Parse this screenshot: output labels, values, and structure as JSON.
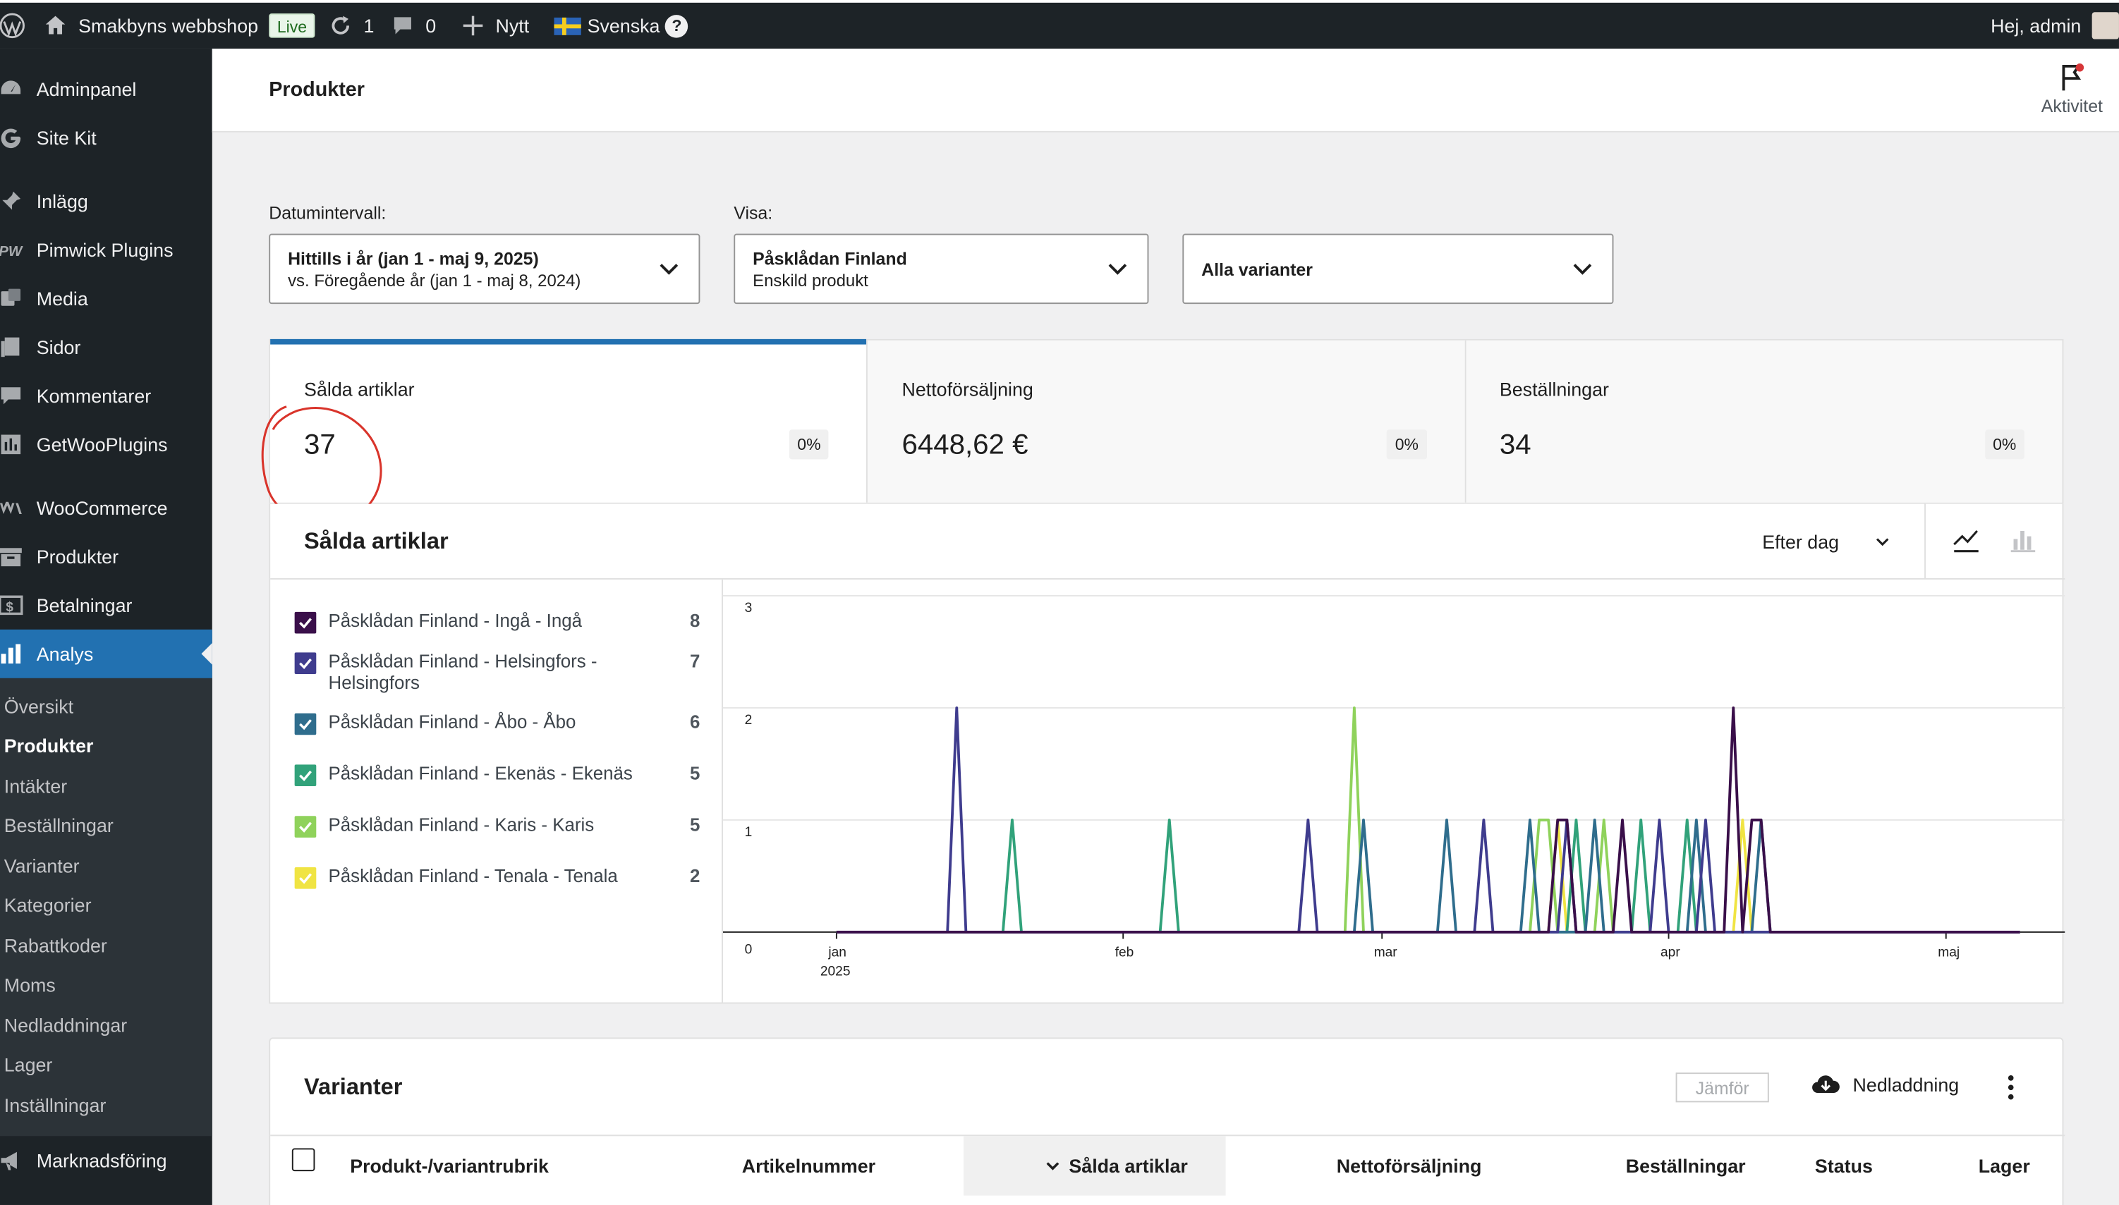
{
  "adminbar": {
    "site_name": "Smakbyns webbshop",
    "live_badge": "Live",
    "updates_count": "1",
    "comments_count": "0",
    "new_label": "Nytt",
    "language": "Svenska",
    "help_glyph": "?",
    "greeting": "Hej, admin"
  },
  "sidebar": {
    "items": [
      {
        "label": "Adminpanel",
        "icon": "dashboard-icon"
      },
      {
        "label": "Site Kit",
        "icon": "google-g-icon"
      },
      {
        "label": "Inlägg",
        "icon": "pin-icon"
      },
      {
        "label": "Pimwick Plugins",
        "icon": "pw-logo-icon"
      },
      {
        "label": "Media",
        "icon": "media-icon"
      },
      {
        "label": "Sidor",
        "icon": "pages-icon"
      },
      {
        "label": "Kommentarer",
        "icon": "comment-icon"
      },
      {
        "label": "GetWooPlugins",
        "icon": "plugin-grid-icon"
      },
      {
        "label": "WooCommerce",
        "icon": "woo-icon"
      },
      {
        "label": "Produkter",
        "icon": "archive-icon"
      },
      {
        "label": "Betalningar",
        "icon": "dollar-icon"
      },
      {
        "label": "Analys",
        "icon": "bar-chart-icon"
      }
    ],
    "submenu": [
      "Översikt",
      "Produkter",
      "Intäkter",
      "Beställningar",
      "Varianter",
      "Kategorier",
      "Rabattkoder",
      "Moms",
      "Nedladdningar",
      "Lager",
      "Inställningar"
    ],
    "after_submenu": [
      {
        "label": "Marknadsföring",
        "icon": "megaphone-icon"
      }
    ]
  },
  "header": {
    "title": "Produkter",
    "activity_label": "Aktivitet"
  },
  "filters": {
    "date_label": "Datumintervall:",
    "date_main": "Hittills i år (jan 1 - maj 9, 2025)",
    "date_sub": "vs. Föregående år (jan 1 - maj 8, 2024)",
    "show_label": "Visa:",
    "show_main": "Påsklådan Finland",
    "show_sub": "Enskild produkt",
    "variant_main": "Alla varianter"
  },
  "summary": [
    {
      "label": "Sålda artiklar",
      "value": "37",
      "delta": "0%"
    },
    {
      "label": "Nettoförsäljning",
      "value": "6448,62 €",
      "delta": "0%"
    },
    {
      "label": "Beställningar",
      "value": "34",
      "delta": "0%"
    }
  ],
  "chart_panel": {
    "title": "Sålda artiklar",
    "interval": "Efter dag"
  },
  "chart_data": {
    "type": "line",
    "ylim": [
      0,
      3
    ],
    "y_ticks": [
      "0",
      "1",
      "2",
      "3"
    ],
    "x_ticks": [
      {
        "label": "jan",
        "sub": "2025",
        "date": "2025-01-01"
      },
      {
        "label": "feb",
        "sub": "",
        "date": "2025-02-01"
      },
      {
        "label": "mar",
        "sub": "",
        "date": "2025-03-01"
      },
      {
        "label": "apr",
        "sub": "",
        "date": "2025-04-01"
      },
      {
        "label": "maj",
        "sub": "",
        "date": "2025-05-01"
      }
    ],
    "x_range": [
      "2025-01-01",
      "2025-05-09"
    ],
    "series": [
      {
        "name": "Påsklådan Finland - Ingå - Ingå",
        "total": "8",
        "color": "#3a0f4a",
        "points": [
          [
            "2025-03-20",
            1
          ],
          [
            "2025-03-21",
            1
          ],
          [
            "2025-03-27",
            1
          ],
          [
            "2025-04-08",
            2
          ],
          [
            "2025-04-10",
            1
          ],
          [
            "2025-04-11",
            1
          ]
        ]
      },
      {
        "name": "Påsklådan Finland - Helsingfors - Helsingfors",
        "total": "7",
        "color": "#3f3c8e",
        "points": [
          [
            "2025-01-14",
            2
          ],
          [
            "2025-02-21",
            1
          ],
          [
            "2025-03-12",
            1
          ],
          [
            "2025-03-21",
            1
          ],
          [
            "2025-03-31",
            1
          ],
          [
            "2025-04-05",
            1
          ]
        ]
      },
      {
        "name": "Påsklådan Finland - Åbo - Åbo",
        "total": "6",
        "color": "#2f6d8d",
        "points": [
          [
            "2025-02-27",
            1
          ],
          [
            "2025-03-08",
            1
          ],
          [
            "2025-03-17",
            1
          ],
          [
            "2025-03-24",
            1
          ],
          [
            "2025-04-04",
            1
          ],
          [
            "2025-04-11",
            1
          ]
        ]
      },
      {
        "name": "Påsklådan Finland - Ekenäs - Ekenäs",
        "total": "5",
        "color": "#31a27a",
        "points": [
          [
            "2025-01-20",
            1
          ],
          [
            "2025-02-06",
            1
          ],
          [
            "2025-03-22",
            1
          ],
          [
            "2025-03-29",
            1
          ],
          [
            "2025-04-03",
            1
          ]
        ]
      },
      {
        "name": "Påsklådan Finland - Karis - Karis",
        "total": "5",
        "color": "#8fd25b",
        "points": [
          [
            "2025-02-26",
            2
          ],
          [
            "2025-03-18",
            1
          ],
          [
            "2025-03-19",
            1
          ],
          [
            "2025-03-25",
            1
          ]
        ]
      },
      {
        "name": "Påsklådan Finland - Tenala - Tenala",
        "total": "2",
        "color": "#f0e443",
        "points": [
          [
            "2025-03-20",
            1
          ],
          [
            "2025-04-09",
            1
          ]
        ]
      }
    ]
  },
  "table": {
    "title": "Varianter",
    "compare_label": "Jämför",
    "download_label": "Nedladdning",
    "columns": [
      "Produkt-/variantrubrik",
      "Artikelnummer",
      "Sålda artiklar",
      "Nettoförsäljning",
      "Beställningar",
      "Status",
      "Lager"
    ]
  }
}
